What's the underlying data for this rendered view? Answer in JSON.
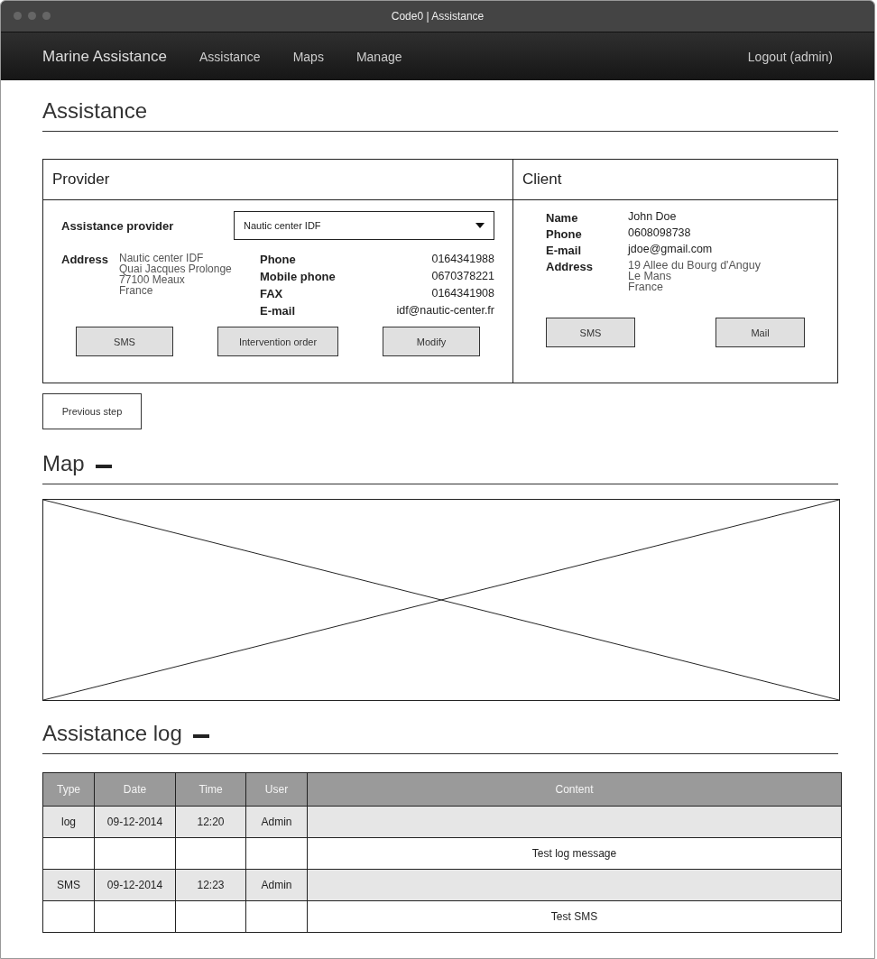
{
  "window": {
    "title": "Code0 | Assistance"
  },
  "navbar": {
    "brand": "Marine Assistance",
    "items": [
      {
        "label": "Assistance"
      },
      {
        "label": "Maps"
      },
      {
        "label": "Manage"
      }
    ],
    "logout": "Logout (admin)"
  },
  "page_title": "Assistance",
  "provider": {
    "title": "Provider",
    "select_label": "Assistance provider",
    "select_value": "Nautic center IDF",
    "address_label": "Address",
    "address_lines": [
      "Nautic center IDF",
      "Quai Jacques Prolonge",
      "77100 Meaux",
      "France"
    ],
    "contacts": [
      {
        "label": "Phone",
        "value": "0164341988"
      },
      {
        "label": "Mobile phone",
        "value": "0670378221"
      },
      {
        "label": "FAX",
        "value": "0164341908"
      },
      {
        "label": "E-mail",
        "value": "idf@nautic-center.fr"
      }
    ],
    "buttons": [
      "SMS",
      "Intervention order",
      "Modify"
    ]
  },
  "client": {
    "title": "Client",
    "fields": [
      {
        "label": "Name",
        "lines": [
          "John Doe"
        ]
      },
      {
        "label": "Phone",
        "lines": [
          "0608098738"
        ]
      },
      {
        "label": "E-mail",
        "lines": [
          "jdoe@gmail.com"
        ]
      },
      {
        "label": "Address",
        "lines": [
          "19 Allee du Bourg d'Anguy",
          "Le Mans",
          "France"
        ]
      }
    ],
    "buttons": [
      "SMS",
      "Mail"
    ]
  },
  "previous_button": "Previous step",
  "map_section": {
    "title": "Map"
  },
  "log_section": {
    "title": "Assistance log",
    "table": {
      "columns": [
        "Type",
        "Date",
        "Time",
        "User",
        "Content"
      ],
      "rows": [
        [
          "log",
          "09-12-2014",
          "12:20",
          "Admin",
          ""
        ],
        [
          "",
          "",
          "",
          "",
          "Test log message"
        ],
        [
          "SMS",
          "09-12-2014",
          "12:23",
          "Admin",
          ""
        ],
        [
          "",
          "",
          "",
          "",
          "Test SMS"
        ]
      ]
    }
  }
}
